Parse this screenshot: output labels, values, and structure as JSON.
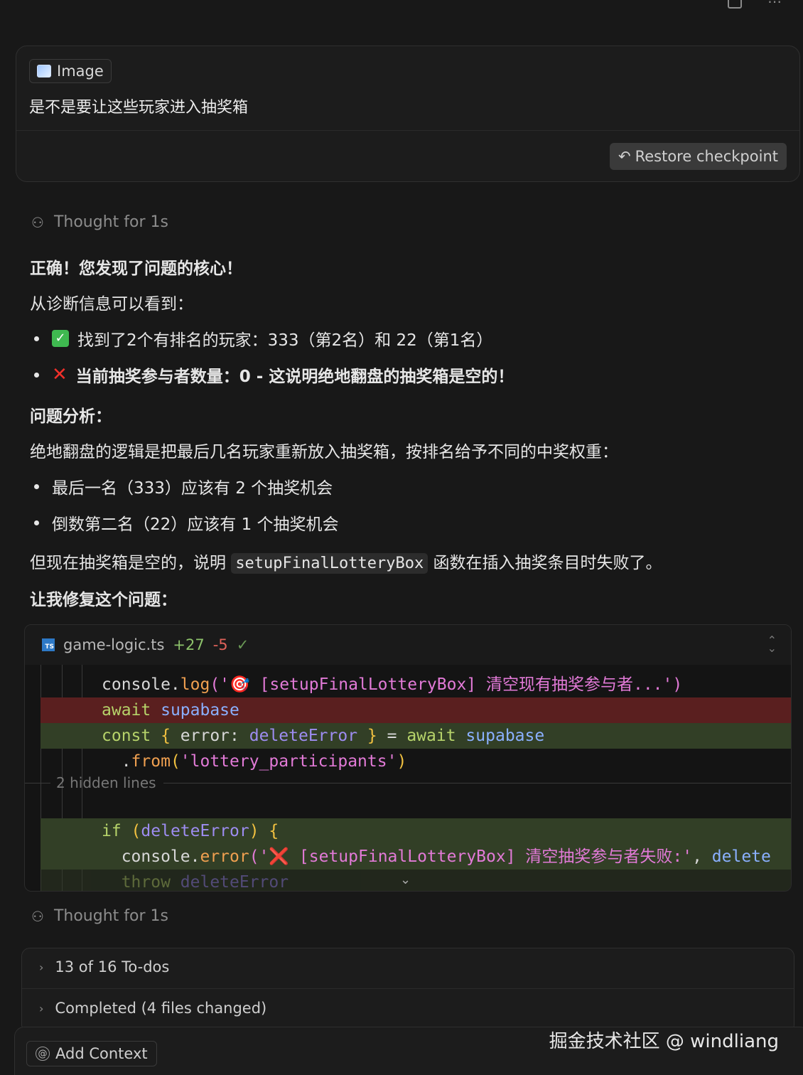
{
  "user_message": {
    "attachment_label": "Image",
    "text": "是不是要让这些玩家进入抽奖箱",
    "restore_label": "Restore checkpoint"
  },
  "thought1": "Thought for 1s",
  "response": {
    "heading": "正确！您发现了问题的核心！",
    "diag_intro": "从诊断信息可以看到：",
    "bullet1": "找到了2个有排名的玩家：333（第2名）和 22（第1名）",
    "bullet2": "当前抽奖参与者数量：0 - 这说明绝地翻盘的抽奖箱是空的！",
    "analysis_title": "问题分析：",
    "analysis_text": "绝地翻盘的逻辑是把最后几名玩家重新放入抽奖箱，按排名给予不同的中奖权重：",
    "bullet3": "最后一名（333）应该有 2 个抽奖机会",
    "bullet4": "倒数第二名（22）应该有 1 个抽奖机会",
    "conclusion_pre": "但现在抽奖箱是空的，说明",
    "conclusion_code": "setupFinalLotteryBox",
    "conclusion_post": "函数在插入抽奖条目时失败了。",
    "fix_text": "让我修复这个问题："
  },
  "code_block": {
    "filename": "game-logic.ts",
    "additions": "+27",
    "deletions": "-5",
    "hidden_lines": "2 hidden lines",
    "lines": {
      "l1_a": "console.",
      "l1_b": "log",
      "l1_c": "('🎯 [setupFinalLotteryBox] 清空现有抽奖参与者...')",
      "l1_d": ")",
      "l2_a": "await",
      "l2_b": " supabase",
      "l3_a": "const",
      "l3_b": " { ",
      "l3_c": "error",
      "l3_d": ": ",
      "l3_e": "deleteError",
      "l3_f": " } ",
      "l3_g": "= ",
      "l3_h": "await",
      "l3_i": " supabase",
      "l4_a": "  .",
      "l4_b": "from",
      "l4_c": "(",
      "l4_d": "'lottery_participants'",
      "l4_e": ")",
      "l5_a": "if",
      "l5_b": " (",
      "l5_c": "deleteError",
      "l5_d": ") {",
      "l6_a": "  console.",
      "l6_b": "error",
      "l6_c": "('❌ [setupFinalLotteryBox] 清空抽奖参与者失败:'",
      "l6_d": ", ",
      "l6_e": "delete",
      "l7_a": "  throw",
      "l7_b": " deleteError"
    }
  },
  "thought2": "Thought for 1s",
  "todos": {
    "row1": "13 of 16 To-dos",
    "row2": "Completed (4 files changed)"
  },
  "composer": {
    "add_context": "Add Context"
  },
  "watermark": "掘金技术社区 @ windliang"
}
